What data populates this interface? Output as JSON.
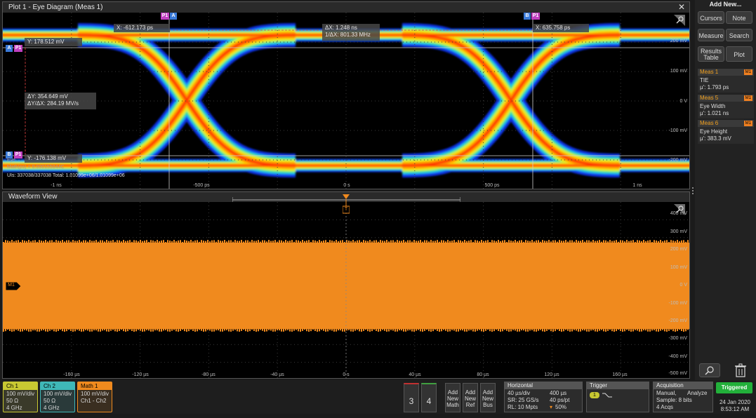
{
  "eye": {
    "title": "Plot 1 - Eye Diagram (Meas 1)",
    "close": "✕",
    "cursor_x_left": "X: -612.173 ps",
    "cursor_x_right": "X: 635.758 ps",
    "delta_x": "ΔX: 1.248 ns",
    "inv_delta_x": "1/ΔX: 801.33 MHz",
    "y_top": "Y: 178.512 mV",
    "y_bottom": "Y: -176.138 mV",
    "delta_y": "ΔY: 354.649 mV",
    "dy_dx": "ΔY/ΔX: 284.19 MV/s",
    "ui_stats": "UIs:  337038/337038   Total:  1.01099e+06/1.01099e+06",
    "faded_label": "Eye",
    "faded_label2": "Math(ps) = 0.000155044C",
    "y_labels": [
      "200 mV",
      "100 mV",
      "0 V",
      "-100 mV",
      "-200 mV"
    ],
    "x_labels": [
      "-1 ns",
      "-500 ps",
      "0 s",
      "500 ps",
      "1 ns"
    ],
    "badge_p1": "P1",
    "badge_a": "A",
    "badge_b": "B"
  },
  "wave": {
    "title": "Waveform View",
    "trigger_marker": "T",
    "math_marker": "M1",
    "y_labels": [
      "400 mV",
      "300 mV",
      "200 mV",
      "100 mV",
      "0 V",
      "-100 mV",
      "-200 mV",
      "-300 mV",
      "-400 mV",
      "-500 mV"
    ],
    "x_labels": [
      "-160 µs",
      "-120 µs",
      "-80 µs",
      "-40 µs",
      "0 s",
      "40 µs",
      "80 µs",
      "120 µs",
      "160 µs"
    ]
  },
  "sidebar": {
    "add_new": "Add New...",
    "buttons": [
      "Cursors",
      "Note",
      "Measure",
      "Search",
      "Results Table",
      "Plot"
    ],
    "measurements": [
      {
        "name": "Meas 1",
        "tag": "M1",
        "type": "TIE",
        "value": "µ': 1.793 ps"
      },
      {
        "name": "Meas 5",
        "tag": "M1",
        "type": "Eye Width",
        "value": "µ': 1.021 ns"
      },
      {
        "name": "Meas 6",
        "tag": "M1",
        "type": "Eye Height",
        "value": "µ': 383.3 mV"
      }
    ]
  },
  "bottom": {
    "ch1": {
      "label": "Ch 1",
      "l1": "100 mV/div",
      "l2": "50 Ω",
      "l3": "4 GHz",
      "color": "#c8c832"
    },
    "ch2": {
      "label": "Ch 2",
      "l1": "100 mV/div",
      "l2": "50 Ω",
      "l3": "4 GHz",
      "color": "#3fb8b8"
    },
    "math1": {
      "label": "Math 1",
      "l1": "100 mV/div",
      "l2": "Ch1 - Ch2",
      "color": "#f08a1e"
    },
    "num3": "3",
    "num4": "4",
    "add_math": [
      "Add",
      "New",
      "Math"
    ],
    "add_ref": [
      "Add",
      "New",
      "Ref"
    ],
    "add_bus": [
      "Add",
      "New",
      "Bus"
    ],
    "horizontal": {
      "title": "Horizontal",
      "a1": "40 µs/div",
      "a2": "400 µs",
      "b1": "SR: 25 GS/s",
      "b2": "40 ps/pt",
      "c1": "RL: 10 Mpts",
      "c2": "50%"
    },
    "trigger": {
      "title": "Trigger",
      "source": "1"
    },
    "acquisition": {
      "title": "Acquisition",
      "a1": "Manual,",
      "a2": "Analyze",
      "b1": "Sample: 8 bits",
      "c1": "4 Acqs"
    },
    "status": "Triggered",
    "date": "24 Jan 2020",
    "time": "8:53:12 AM"
  }
}
